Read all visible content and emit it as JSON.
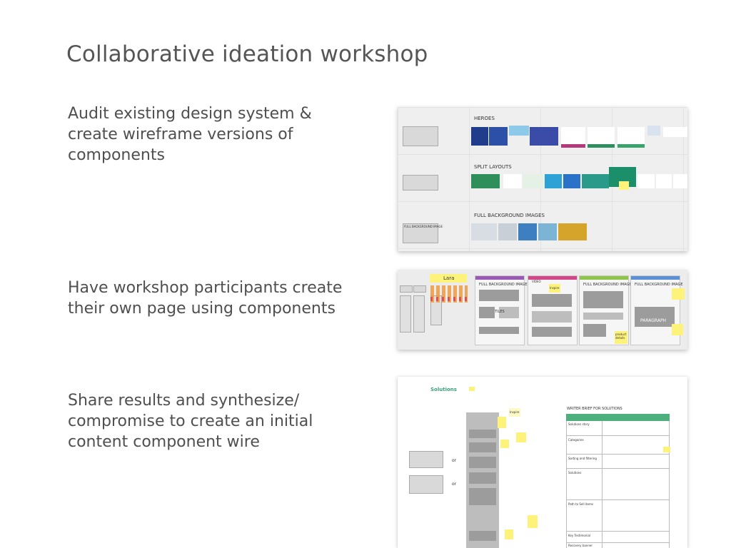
{
  "slide": {
    "title": "Collaborative ideation workshop",
    "steps": [
      "Audit existing design system & create wireframe versions of components",
      "Have workshop participants create their own page using components",
      "Share results and synthesize/ compromise to create an initial content component wire"
    ]
  },
  "board1": {
    "rows": [
      "HEROES",
      "SPLIT LAYOUTS",
      "FULL BACKGROUND IMAGES"
    ],
    "wire_label": "FULL BACKGROUND IMAGE"
  },
  "board2": {
    "name_tag": "Lara",
    "columns": [
      "FULL BACKGROUND IMAGE",
      "FULL BACKGROUND IMAGE",
      "FULL BACKGROUND IMAGE"
    ],
    "wire_tiles": "TILES",
    "wire_paragraph": "PARAGRAPH",
    "wire_video": "VIDEO",
    "sticky_inspire": "Inspire",
    "sticky_product": "product details"
  },
  "board3": {
    "heading": "Solutions",
    "brief_title": "WRITER BRIEF FOR SOLUTIONS",
    "or_label": "or",
    "sticky_inspire": "Inspire",
    "table_rows": [
      "Solutions story",
      "Categories",
      "Sorting and filtering",
      "Solutions",
      "Path to Sell items",
      "Key Testimonial",
      "Recovery banner"
    ]
  },
  "colors": {
    "title": "#555555",
    "text": "#4f4f4f",
    "sticky": "#fdf27a",
    "table_header": "#4caf7c",
    "solutions_heading": "#3aa37a"
  }
}
